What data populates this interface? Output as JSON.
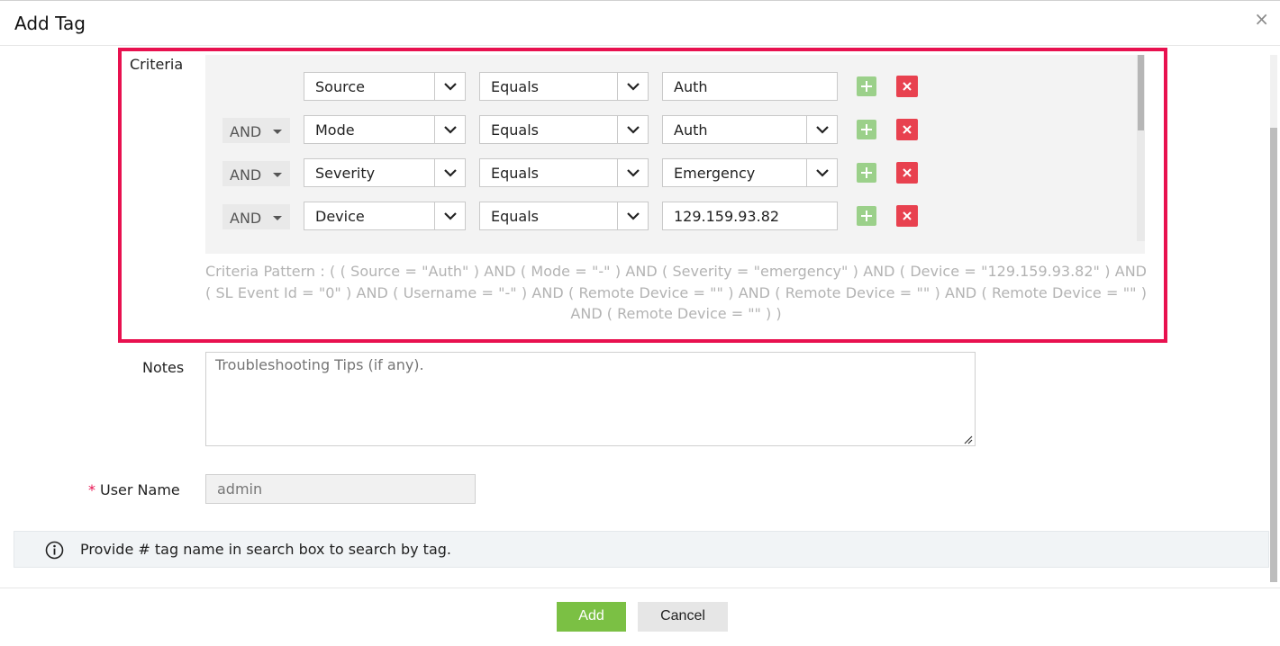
{
  "dialog": {
    "title": "Add Tag",
    "close_glyph": "×"
  },
  "labels": {
    "criteria": "Criteria",
    "notes": "Notes",
    "user_name": "User Name",
    "required_mark": "*"
  },
  "criteria": {
    "rows": [
      {
        "conjunction": "",
        "field": "Source",
        "operator": "Equals",
        "value": "Auth",
        "value_type": "text"
      },
      {
        "conjunction": "AND",
        "field": "Mode",
        "operator": "Equals",
        "value": "Auth",
        "value_type": "select"
      },
      {
        "conjunction": "AND",
        "field": "Severity",
        "operator": "Equals",
        "value": "Emergency",
        "value_type": "select"
      },
      {
        "conjunction": "AND",
        "field": "Device",
        "operator": "Equals",
        "value": "129.159.93.82",
        "value_type": "text"
      }
    ],
    "pattern": "Criteria Pattern : ( ( Source = \"Auth\" ) AND ( Mode = \"-\" ) AND ( Severity = \"emergency\" ) AND ( Device = \"129.159.93.82\" ) AND ( SL Event Id = \"0\" ) AND ( Username = \"-\" ) AND ( Remote Device = \"\" ) AND ( Remote Device = \"\" ) AND ( Remote Device = \"\" ) AND ( Remote Device = \"\" ) )"
  },
  "notes": {
    "placeholder": "Troubleshooting Tips (if any)."
  },
  "user": {
    "name": "admin"
  },
  "info": {
    "message": "Provide # tag name in search box to search by tag."
  },
  "buttons": {
    "add": "Add",
    "cancel": "Cancel"
  },
  "colors": {
    "highlight": "#e8114f",
    "add_button": "#7bc044",
    "add_row": "#9bd08a",
    "delete_row": "#e8414f"
  },
  "icons": {
    "add_row": "plus-icon",
    "delete_row": "close-x-icon",
    "info": "info-circle-icon",
    "dropdown": "chevron-down-icon"
  }
}
